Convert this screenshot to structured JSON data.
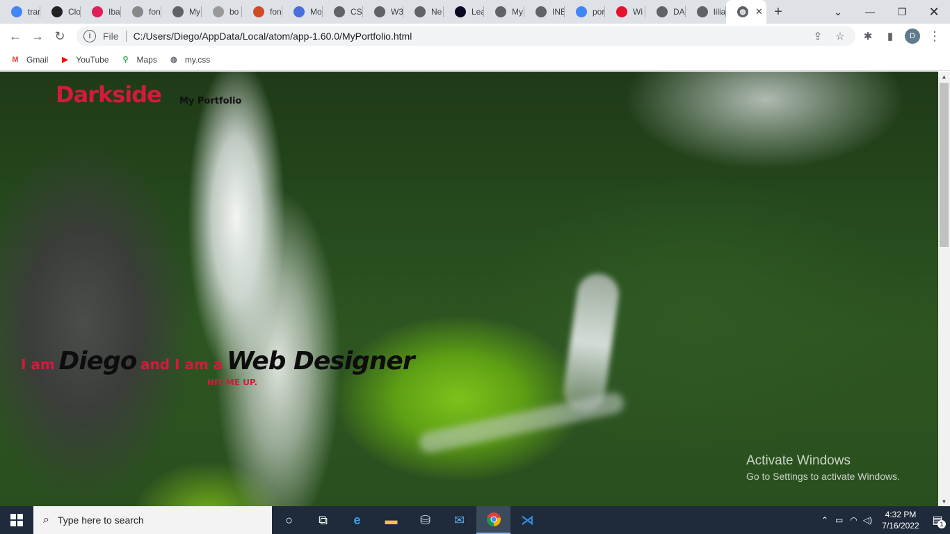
{
  "tabs": [
    {
      "label": "trar",
      "icon": "google-icon",
      "color": "#4285f4"
    },
    {
      "label": "Clo",
      "icon": "codepen-icon",
      "color": "#222222"
    },
    {
      "label": "Iba",
      "icon": "slack-icon",
      "color": "#e01e5a"
    },
    {
      "label": "fon",
      "icon": "font-icon",
      "color": "#888888"
    },
    {
      "label": "My",
      "icon": "globe-icon",
      "color": "#5f6368"
    },
    {
      "label": "bo",
      "icon": "box-icon",
      "color": "#999999"
    },
    {
      "label": "fon",
      "icon": "code-icon",
      "color": "#d04a2a"
    },
    {
      "label": "Mo",
      "icon": "flag-icon",
      "color": "#4a6ee0"
    },
    {
      "label": "CSS",
      "icon": "globe-icon",
      "color": "#5f6368"
    },
    {
      "label": "W3",
      "icon": "globe-icon",
      "color": "#5f6368"
    },
    {
      "label": "Ne",
      "icon": "chromium-icon",
      "color": "#5f6368"
    },
    {
      "label": "Lea",
      "icon": "fcc-icon",
      "color": "#0a0a23"
    },
    {
      "label": "My",
      "icon": "globe-icon",
      "color": "#5f6368"
    },
    {
      "label": "INE",
      "icon": "globe-icon",
      "color": "#5f6368"
    },
    {
      "label": "por",
      "icon": "google-icon",
      "color": "#4285f4"
    },
    {
      "label": "Wi",
      "icon": "wix-icon",
      "color": "#e8112d"
    },
    {
      "label": "DA",
      "icon": "globe-icon",
      "color": "#5f6368"
    },
    {
      "label": "lilia",
      "icon": "globe-icon",
      "color": "#5f6368"
    }
  ],
  "active_tab": {
    "icon": "globe-icon",
    "close": "✕"
  },
  "new_tab": "+",
  "address": {
    "protocol": "File",
    "url": "C:/Users/Diego/AppData/Local/atom/app-1.60.0/MyPortfolio.html"
  },
  "profile_initial": "D",
  "bookmarks": [
    {
      "label": "Gmail",
      "icon": "gmail-icon",
      "color": "#ea4335"
    },
    {
      "label": "YouTube",
      "icon": "youtube-icon",
      "color": "#ff0000"
    },
    {
      "label": "Maps",
      "icon": "maps-icon",
      "color": "#34a853"
    },
    {
      "label": "my.css",
      "icon": "globe-icon",
      "color": "#5f6368"
    }
  ],
  "site": {
    "brand": "Darkside",
    "brand_sub": "My Portfolio",
    "hero_prefix": "I am",
    "hero_name": "Diego",
    "hero_mid": "and I am a",
    "hero_role": "Web Designer",
    "cta": "HIT ME UP."
  },
  "watermark": {
    "title": "Activate Windows",
    "subtitle": "Go to Settings to activate Windows."
  },
  "taskbar": {
    "search_placeholder": "Type here to search",
    "time": "4:32 PM",
    "date": "7/16/2022",
    "notifications": "1"
  },
  "colors": {
    "brand_red": "#d41a3c",
    "hero_dark": "#0d0d0d"
  }
}
